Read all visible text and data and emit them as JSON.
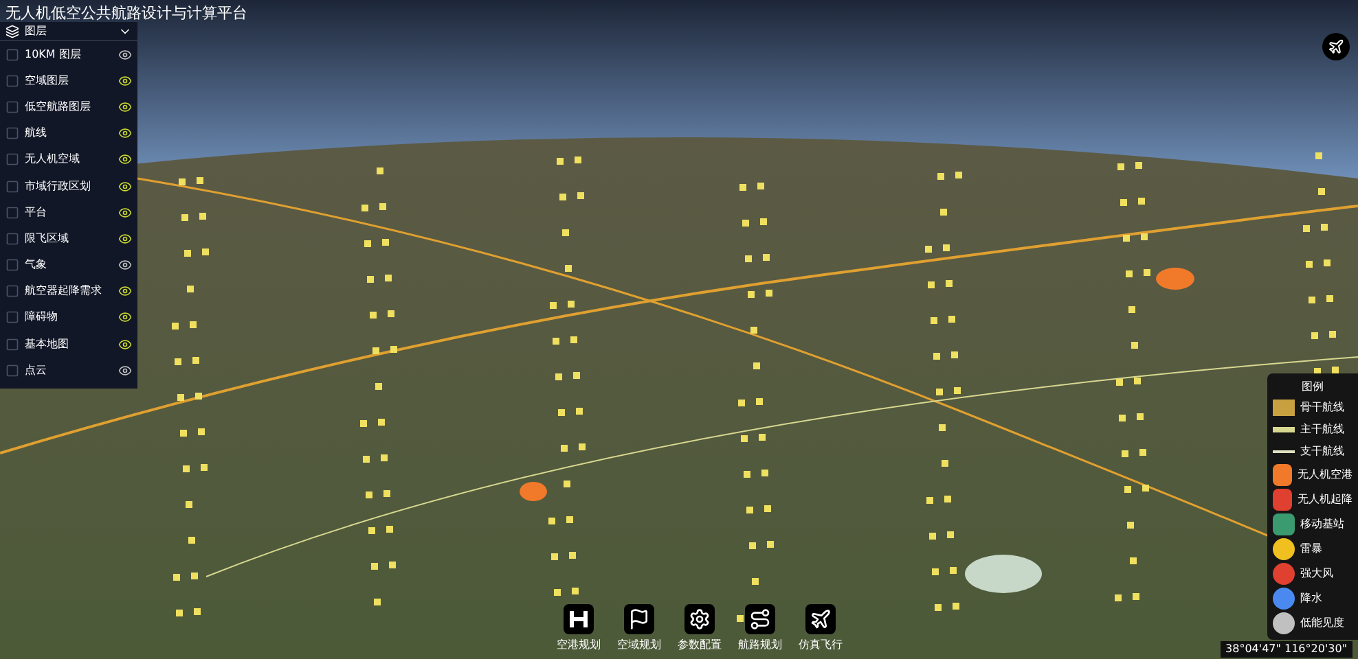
{
  "window": {
    "title": "无人机低空公共航路设计与计算平台"
  },
  "layers_panel": {
    "title": "图层",
    "expanded": true,
    "items": [
      {
        "label": "10KM 图层",
        "visible": false
      },
      {
        "label": "空域图层",
        "visible": true
      },
      {
        "label": "低空航路图层",
        "visible": true
      },
      {
        "label": "航线",
        "visible": true
      },
      {
        "label": "无人机空域",
        "visible": true
      },
      {
        "label": "市域行政区划",
        "visible": true
      },
      {
        "label": "平台",
        "visible": true
      },
      {
        "label": "限飞区域",
        "visible": true
      },
      {
        "label": "气象",
        "visible": false
      },
      {
        "label": "航空器起降需求",
        "visible": true
      },
      {
        "label": "障碍物",
        "visible": true
      },
      {
        "label": "基本地图",
        "visible": true
      },
      {
        "label": "点云",
        "visible": false
      }
    ]
  },
  "legend": {
    "title": "图例",
    "items": [
      {
        "label": "骨干航线",
        "kind": "area",
        "color": "#c9a040"
      },
      {
        "label": "主干航线",
        "kind": "line",
        "color": "#d8d890"
      },
      {
        "label": "支干航线",
        "kind": "thin",
        "color": "#e0e0c0"
      },
      {
        "label": "无人机空港",
        "kind": "square",
        "color": "#f07a2a"
      },
      {
        "label": "无人机起降",
        "kind": "square",
        "color": "#e04030"
      },
      {
        "label": "移动基站",
        "kind": "square",
        "color": "#3a9a70"
      },
      {
        "label": "雷暴",
        "kind": "circle",
        "color": "#f0c020"
      },
      {
        "label": "强大风",
        "kind": "circle",
        "color": "#e04030"
      },
      {
        "label": "降水",
        "kind": "circle",
        "color": "#4a8af0"
      },
      {
        "label": "低能见度",
        "kind": "circle",
        "color": "#c0c0c0"
      }
    ]
  },
  "toolbar": [
    {
      "label": "空港规划",
      "kind": "h"
    },
    {
      "label": "空域规划",
      "kind": "flag"
    },
    {
      "label": "参数配置",
      "kind": "gear"
    },
    {
      "label": "航路规划",
      "kind": "route"
    },
    {
      "label": "仿真飞行",
      "kind": "plane"
    }
  ],
  "status_bar": {
    "coordinates": "38°04'47\" 116°20'30\""
  }
}
